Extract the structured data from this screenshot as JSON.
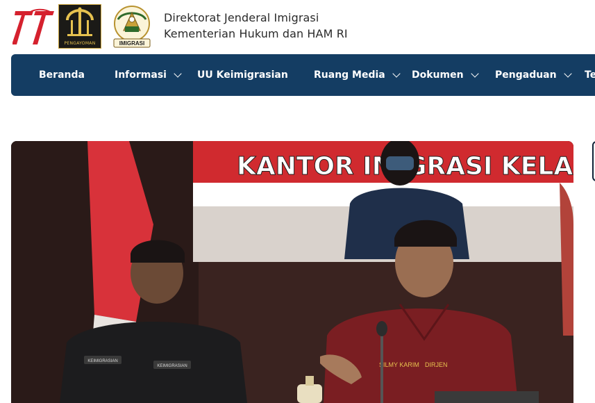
{
  "header": {
    "logo_77_label": "77",
    "pengayoman_label": "PENGAYOMAN",
    "imigrasi_label": "IMIGRASI",
    "title_line1": "Direktorat Jenderal Imigrasi",
    "title_line2": "Kementerian Hukum dan HAM RI"
  },
  "nav": {
    "items": [
      {
        "label": "Beranda",
        "dropdown": false
      },
      {
        "label": "Informasi",
        "dropdown": true
      },
      {
        "label": "UU Keimigrasian",
        "dropdown": false
      },
      {
        "label": "Ruang Media",
        "dropdown": true
      },
      {
        "label": "Dokumen",
        "dropdown": true
      },
      {
        "label": "Pengaduan",
        "dropdown": true
      },
      {
        "label": "Te",
        "dropdown": false
      }
    ]
  },
  "hero": {
    "banner_text": "KANTOR IMIGRASI KELAS I",
    "badge_left_1": "KEIMIGRASIAN",
    "badge_left_2": "KEIMIGRASIAN",
    "badge_right_name": "SILMY KARIM",
    "badge_right_role": "DIRJEN"
  },
  "colors": {
    "nav_background": "#143d63",
    "accent_red": "#d01f2a",
    "gold": "#c9a23a"
  }
}
